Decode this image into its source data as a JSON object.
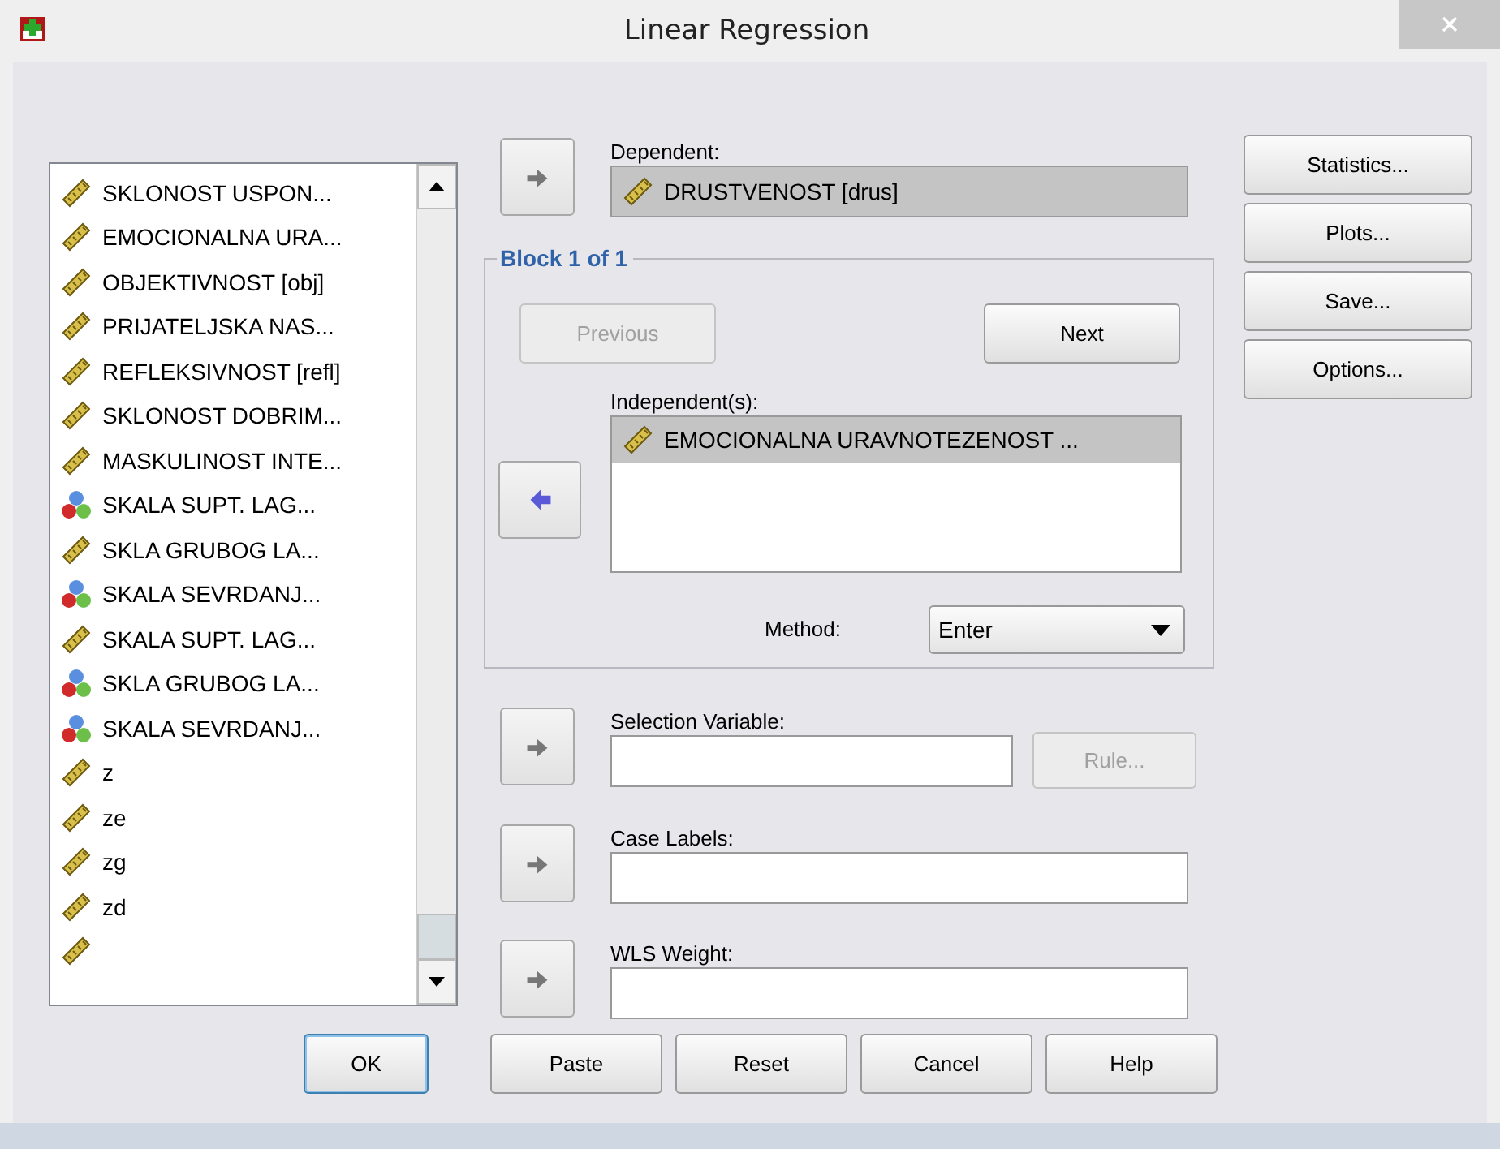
{
  "window": {
    "title": "Linear Regression"
  },
  "variables": [
    {
      "label": "SKLONOST USPON...",
      "kind": "scale"
    },
    {
      "label": "EMOCIONALNA URA...",
      "kind": "scale"
    },
    {
      "label": "OBJEKTIVNOST [obj]",
      "kind": "scale"
    },
    {
      "label": "PRIJATELJSKA NAS...",
      "kind": "scale"
    },
    {
      "label": "REFLEKSIVNOST [refl]",
      "kind": "scale"
    },
    {
      "label": "SKLONOST DOBRIM...",
      "kind": "scale"
    },
    {
      "label": "MASKULINOST INTE...",
      "kind": "scale"
    },
    {
      "label": "SKALA SUPT. LAG...",
      "kind": "nominal"
    },
    {
      "label": "SKLA GRUBOG LA...",
      "kind": "scale"
    },
    {
      "label": "SKALA SEVRDANJ...",
      "kind": "nominal"
    },
    {
      "label": "SKALA SUPT. LAG...",
      "kind": "scale"
    },
    {
      "label": "SKLA GRUBOG LA...",
      "kind": "nominal"
    },
    {
      "label": "SKALA SEVRDANJ...",
      "kind": "nominal"
    },
    {
      "label": "z",
      "kind": "scale"
    },
    {
      "label": "ze",
      "kind": "scale"
    },
    {
      "label": "zg",
      "kind": "scale"
    },
    {
      "label": "zd",
      "kind": "scale"
    },
    {
      "kind": "scale"
    }
  ],
  "dependent": {
    "label": "Dependent:",
    "kind": "right",
    "variable": {
      "label": "DRUSTVENOST [drus]",
      "kind": "scale"
    }
  },
  "block": {
    "title": "Block 1 of 1",
    "previous": {
      "label": "Previous",
      "disabled": true
    },
    "next": {
      "label": "Next",
      "disabled": false
    },
    "independents": {
      "label": "Independent(s):",
      "kind": "left",
      "items": [
        {
          "label": "EMOCIONALNA URAVNOTEZENOST ...",
          "kind": "scale",
          "selected": true
        }
      ]
    },
    "method": {
      "label": "Method:",
      "value": "Enter"
    }
  },
  "fields": [
    {
      "label": "Selection Variable:",
      "kind": "right",
      "rule": {
        "label": "Rule...",
        "disabled": true
      }
    },
    {
      "label": "Case Labels:",
      "kind": "right"
    },
    {
      "label": "WLS Weight:",
      "kind": "right"
    }
  ],
  "side_buttons": [
    {
      "label": "Statistics..."
    },
    {
      "label": "Plots..."
    },
    {
      "label": "Save..."
    },
    {
      "label": "Options..."
    }
  ],
  "bottom_buttons": [
    {
      "label": "OK",
      "default": true
    },
    {
      "label": "Paste",
      "default": false
    },
    {
      "label": "Reset",
      "default": false
    },
    {
      "label": "Cancel",
      "default": false
    },
    {
      "label": "Help",
      "default": false
    }
  ]
}
